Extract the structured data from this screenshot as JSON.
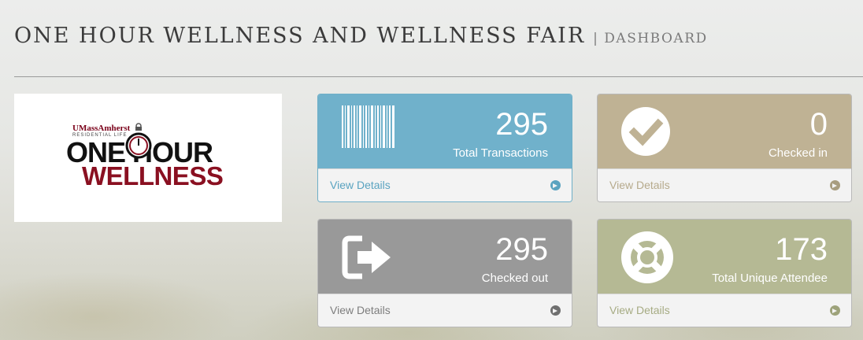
{
  "header": {
    "title": "ONE HOUR WELLNESS AND WELLNESS FAIR",
    "subtitle": "| DASHBOARD"
  },
  "logo": {
    "university": "UMassAmherst",
    "unit": "RESIDENTIAL LIFE",
    "line1": "ONE HOUR",
    "line2": "WELLNESS"
  },
  "cards": [
    {
      "number": "295",
      "label": "Total Transactions",
      "link": "View Details",
      "icon": "barcode-icon",
      "color": "#70b1cb"
    },
    {
      "number": "0",
      "label": "Checked in",
      "link": "View Details",
      "icon": "check-circle-icon",
      "color": "#bfb294"
    },
    {
      "number": "295",
      "label": "Checked out",
      "link": "View Details",
      "icon": "sign-out-icon",
      "color": "#999999"
    },
    {
      "number": "173",
      "label": "Total Unique Attendee",
      "link": "View Details",
      "icon": "life-ring-icon",
      "color": "#b5b994"
    }
  ]
}
